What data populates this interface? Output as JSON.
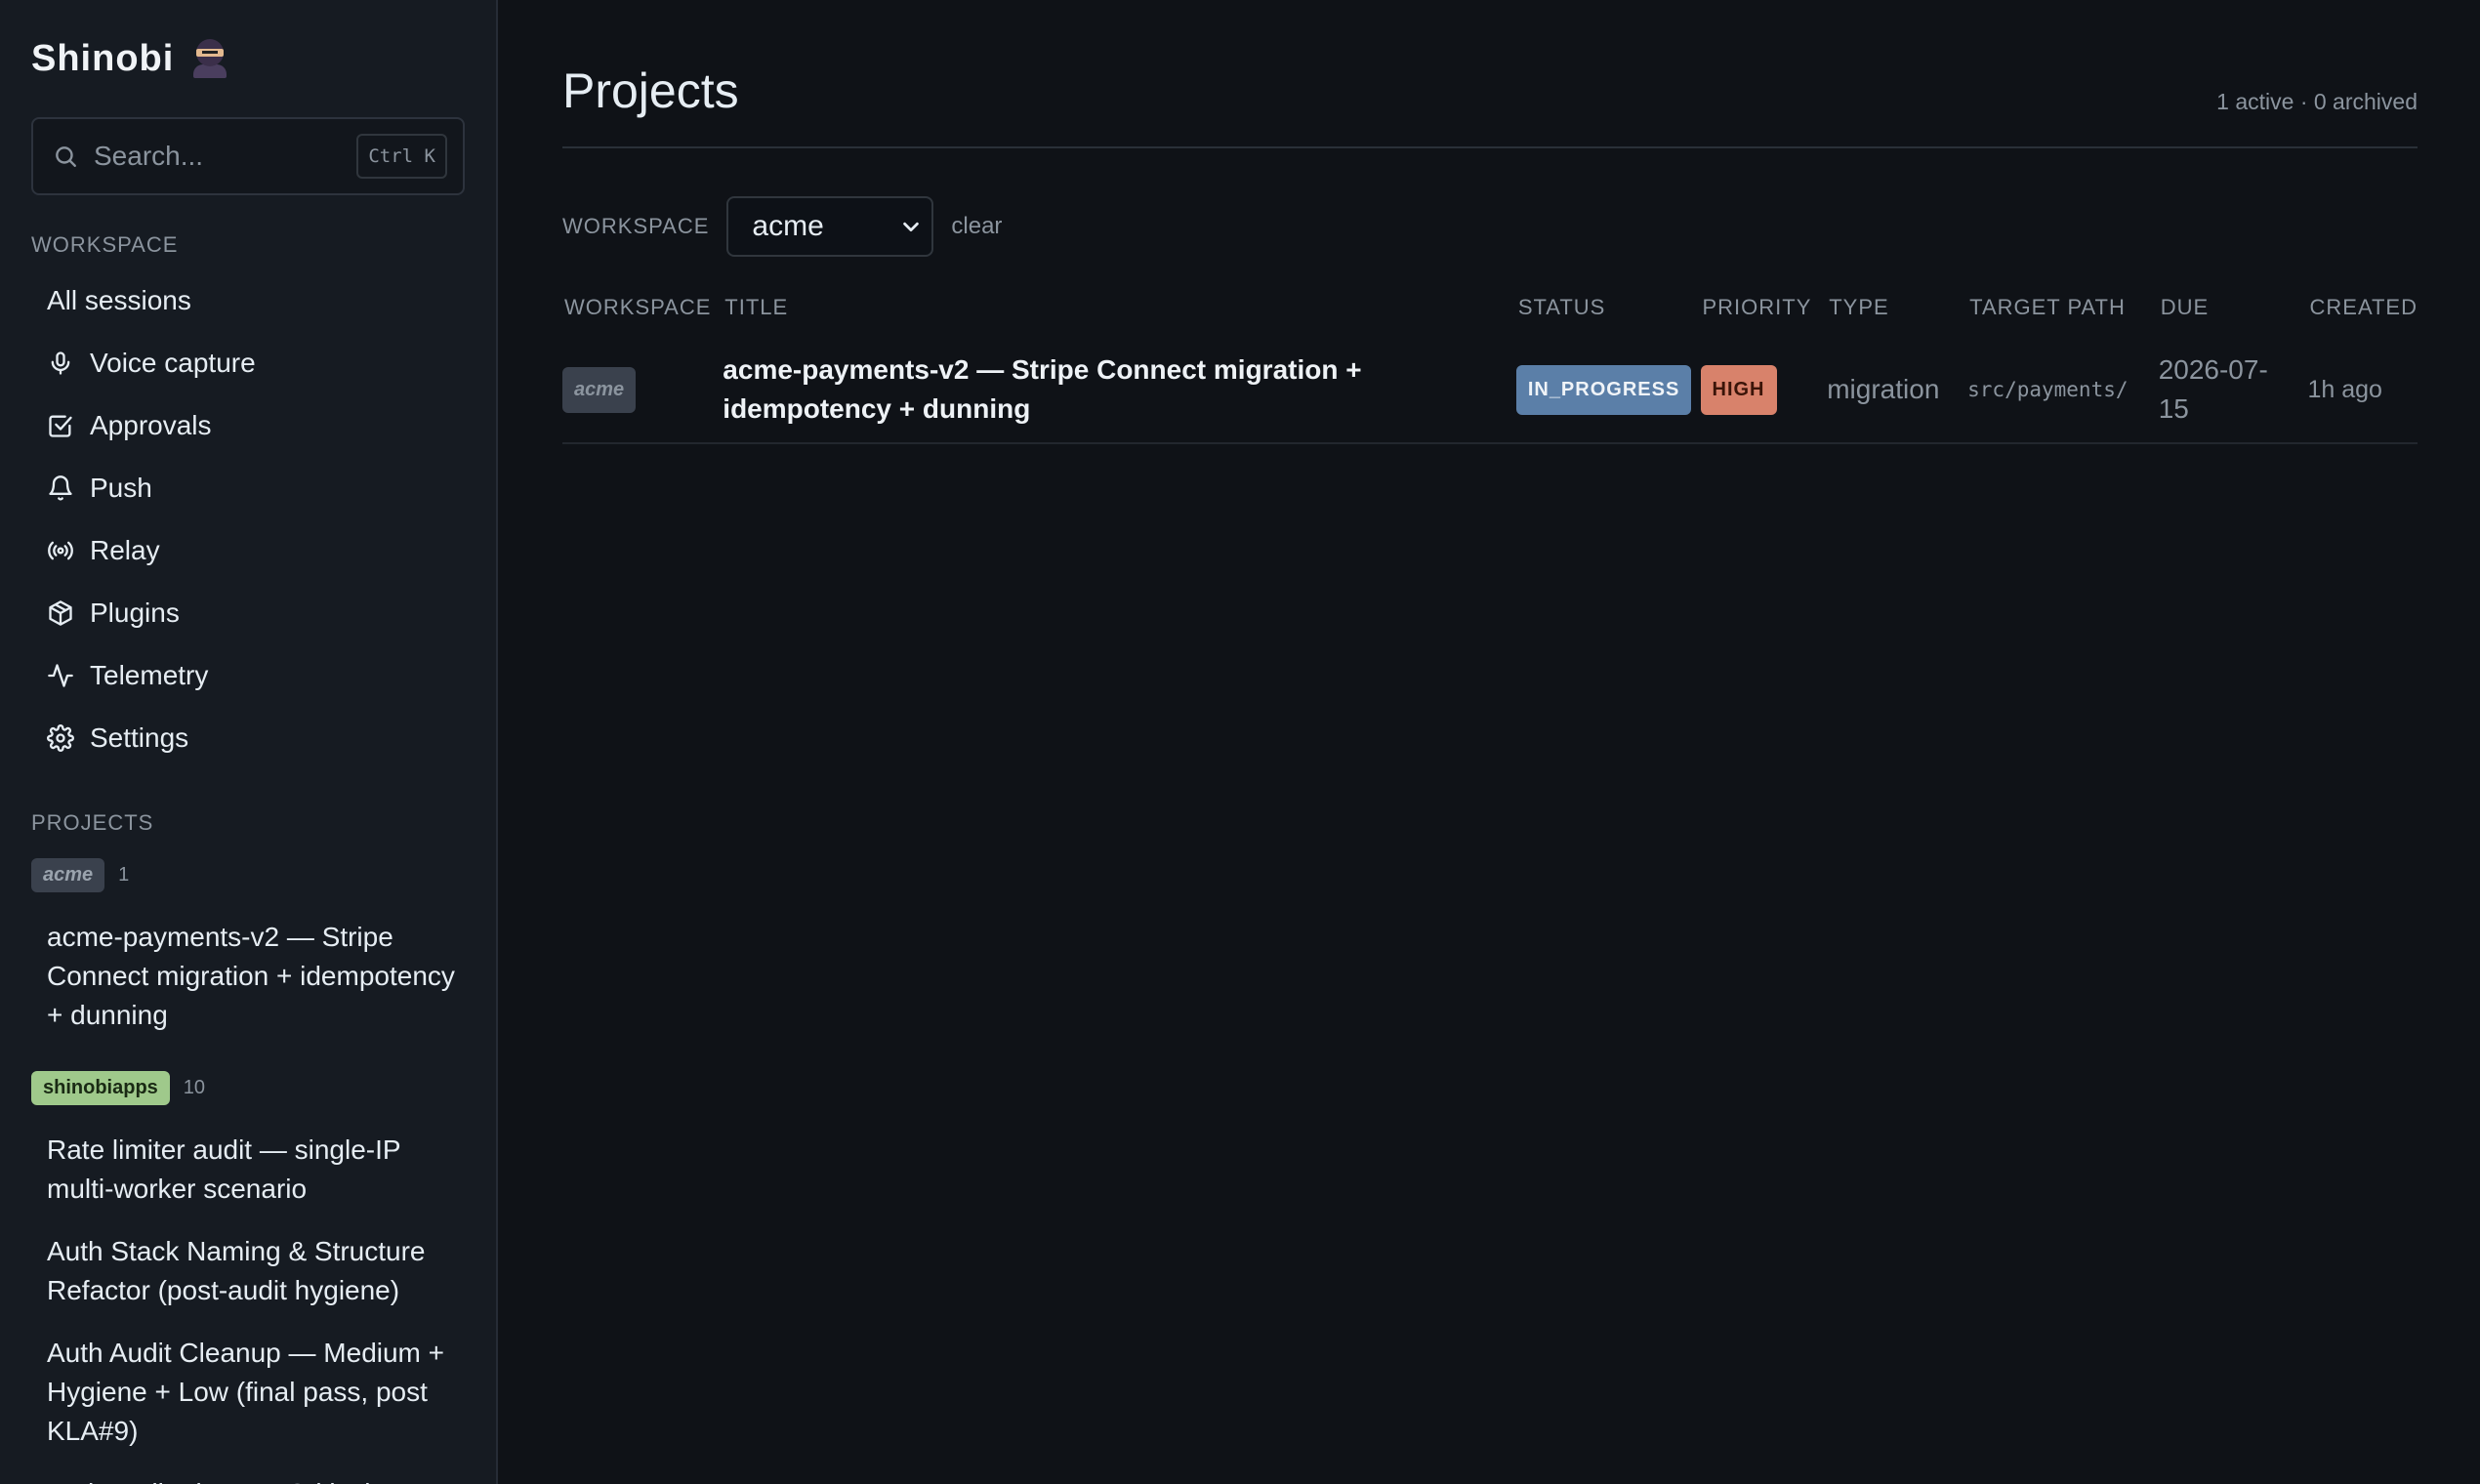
{
  "app": {
    "title": "Shinobi"
  },
  "search": {
    "placeholder": "Search...",
    "shortcut": "Ctrl K"
  },
  "sidebar": {
    "workspace_heading": "WORKSPACE",
    "nav": [
      {
        "label": "All sessions",
        "icon": "none"
      },
      {
        "label": "Voice capture",
        "icon": "microphone-icon"
      },
      {
        "label": "Approvals",
        "icon": "checkbox-icon"
      },
      {
        "label": "Push",
        "icon": "bell-icon"
      },
      {
        "label": "Relay",
        "icon": "broadcast-icon"
      },
      {
        "label": "Plugins",
        "icon": "package-icon"
      },
      {
        "label": "Telemetry",
        "icon": "activity-icon"
      },
      {
        "label": "Settings",
        "icon": "gear-icon"
      }
    ],
    "projects_heading": "PROJECTS",
    "groups": [
      {
        "tag": "acme",
        "count": "1",
        "items": [
          "acme-payments-v2 — Stripe Connect migration + idempotency + dunning"
        ]
      },
      {
        "tag": "shinobiapps",
        "count": "10",
        "items": [
          "Rate limiter audit — single-IP multi-worker scenario",
          "Auth Stack Naming & Structure Refactor (post-audit hygiene)",
          "Auth Audit Cleanup — Medium + Hygiene + Low (final pass, post KLA#9)",
          "Auth Audit Fixes — Critical"
        ]
      }
    ]
  },
  "main": {
    "title": "Projects",
    "meta": "1 active · 0 archived",
    "filter": {
      "label": "WORKSPACE",
      "value": "acme",
      "clear": "clear"
    },
    "columns": [
      "WORKSPACE",
      "TITLE",
      "STATUS",
      "PRIORITY",
      "TYPE",
      "TARGET PATH",
      "DUE",
      "CREATED"
    ],
    "rows": [
      {
        "workspace": "acme",
        "title": "acme-payments-v2 — Stripe Connect migration + idempotency + dunning",
        "status": "IN_PROGRESS",
        "priority": "HIGH",
        "type": "migration",
        "target_path": "src/payments/",
        "due": "2026-07-15",
        "created": "1h ago"
      }
    ]
  },
  "colors": {
    "background": "#0f1217",
    "sidebar": "#161b22",
    "status": "#5b7fa8",
    "priority_high": "#d8826b",
    "tag_shinobiapps": "#9fc98b"
  }
}
